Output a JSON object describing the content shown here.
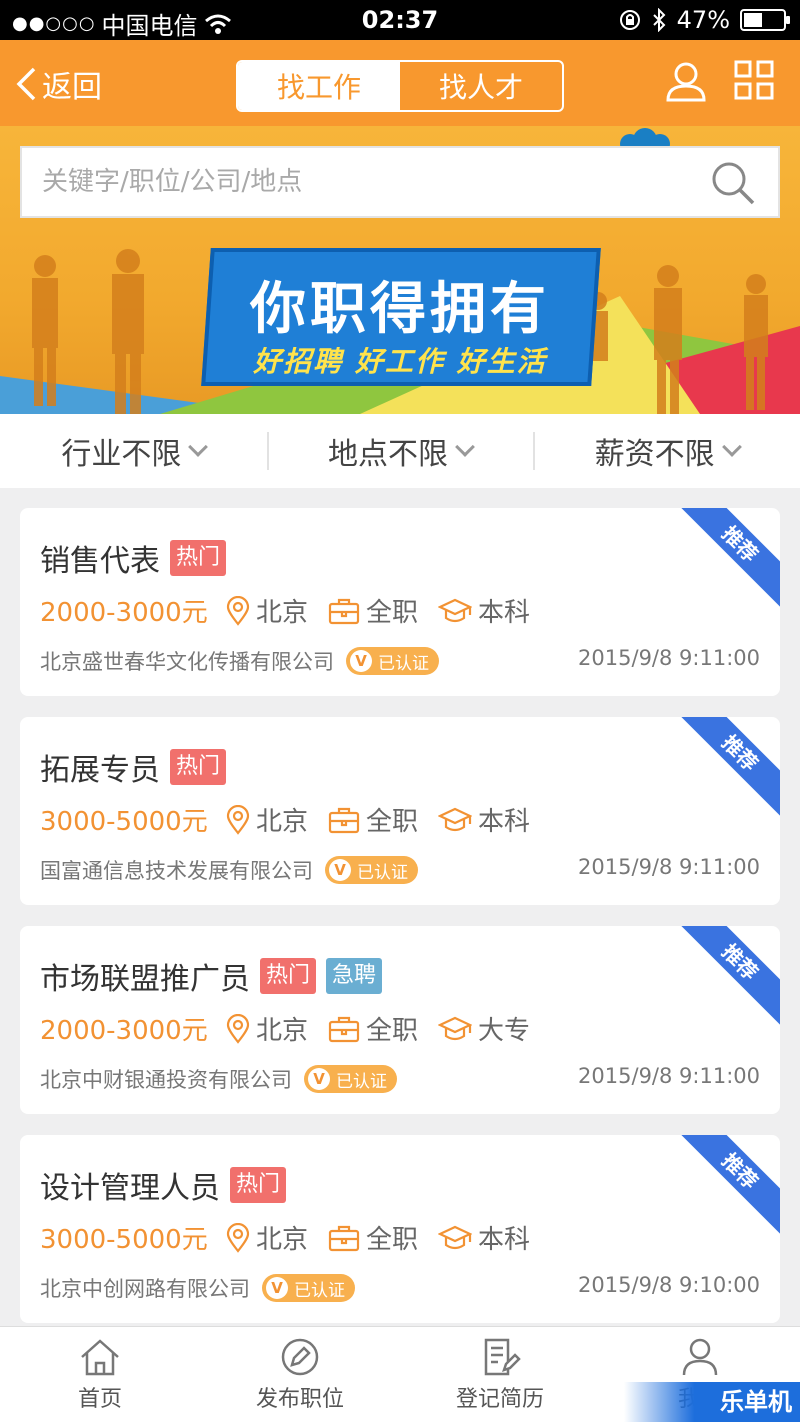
{
  "status_bar": {
    "signal": "●●○○○",
    "carrier": "中国电信",
    "time": "02:37",
    "battery": "47%",
    "battery_level": 0.47
  },
  "nav": {
    "back_label": "返回",
    "tabs": [
      "找工作",
      "找人才"
    ]
  },
  "search": {
    "placeholder": "关键字/职位/公司/地点"
  },
  "banner": {
    "main": "你职得拥有",
    "sub": "好招聘 好工作 好生活"
  },
  "filters": [
    "行业不限",
    "地点不限",
    "薪资不限"
  ],
  "jobs": [
    {
      "title": "销售代表",
      "tags": [
        "热门"
      ],
      "salary": "2000-3000元",
      "location": "北京",
      "type": "全职",
      "education": "本科",
      "company": "北京盛世春华文化传播有限公司",
      "verified": "已认证",
      "date": "2015/9/8 9:11:00",
      "ribbon": "推荐"
    },
    {
      "title": "拓展专员",
      "tags": [
        "热门"
      ],
      "salary": "3000-5000元",
      "location": "北京",
      "type": "全职",
      "education": "本科",
      "company": "国富通信息技术发展有限公司",
      "verified": "已认证",
      "date": "2015/9/8 9:11:00",
      "ribbon": "推荐"
    },
    {
      "title": "市场联盟推广员",
      "tags": [
        "热门",
        "急聘"
      ],
      "salary": "2000-3000元",
      "location": "北京",
      "type": "全职",
      "education": "大专",
      "company": "北京中财银通投资有限公司",
      "verified": "已认证",
      "date": "2015/9/8 9:11:00",
      "ribbon": "推荐"
    },
    {
      "title": "设计管理人员",
      "tags": [
        "热门"
      ],
      "salary": "3000-5000元",
      "location": "北京",
      "type": "全职",
      "education": "本科",
      "company": "北京中创网路有限公司",
      "verified": "已认证",
      "date": "2015/9/8 9:10:00",
      "ribbon": "推荐"
    }
  ],
  "tabbar": [
    "首页",
    "发布职位",
    "登记简历",
    "我的"
  ],
  "watermark": "乐单机",
  "colors": {
    "primary_orange": "#f8982e",
    "salary": "#f29233",
    "hot_tag": "#f1706c",
    "urgent_tag": "#6aaed2",
    "ribbon": "#3a73e0"
  }
}
